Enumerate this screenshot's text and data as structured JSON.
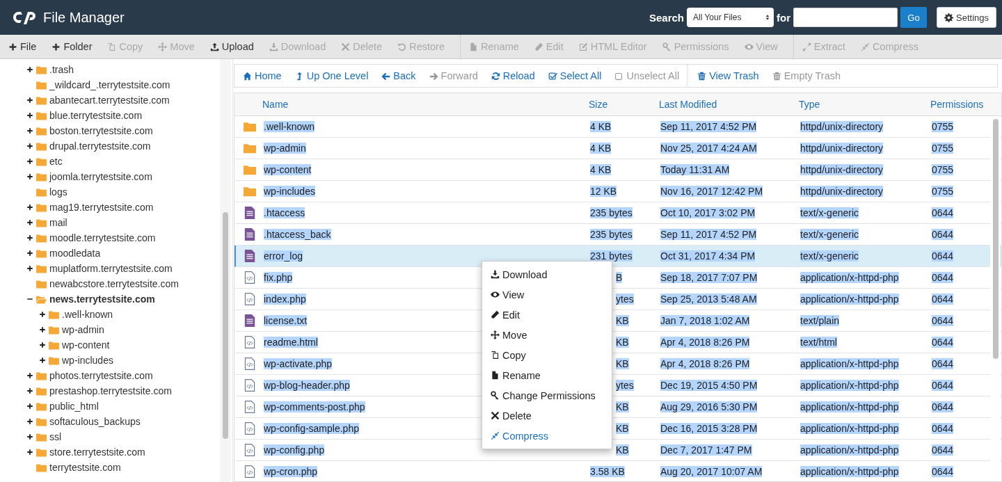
{
  "header": {
    "title": "File Manager",
    "search_label": "Search",
    "scope": "All Your Files",
    "for_label": "for",
    "go": "Go",
    "settings": "Settings"
  },
  "toolbar": [
    [
      {
        "label": "File",
        "disabled": false
      },
      {
        "label": "Folder",
        "disabled": false
      },
      {
        "label": "Copy",
        "disabled": true
      },
      {
        "label": "Move",
        "disabled": true
      },
      {
        "label": "Upload",
        "disabled": false
      },
      {
        "label": "Download",
        "disabled": true
      },
      {
        "label": "Delete",
        "disabled": true
      },
      {
        "label": "Restore",
        "disabled": true
      }
    ],
    [
      {
        "label": "Rename",
        "disabled": true
      },
      {
        "label": "Edit",
        "disabled": true
      },
      {
        "label": "HTML Editor",
        "disabled": true
      },
      {
        "label": "Permissions",
        "disabled": true
      },
      {
        "label": "View",
        "disabled": true
      }
    ],
    [
      {
        "label": "Extract",
        "disabled": true
      },
      {
        "label": "Compress",
        "disabled": true
      }
    ]
  ],
  "tree": [
    {
      "label": ".trash",
      "expandable": true,
      "expanded": false,
      "current": false
    },
    {
      "label": "_wildcard_.terrytestsite.com",
      "expandable": false,
      "expanded": false,
      "current": false
    },
    {
      "label": "abantecart.terrytestsite.com",
      "expandable": true,
      "expanded": false,
      "current": false
    },
    {
      "label": "blue.terrytestsite.com",
      "expandable": true,
      "expanded": false,
      "current": false
    },
    {
      "label": "boston.terrytestsite.com",
      "expandable": true,
      "expanded": false,
      "current": false
    },
    {
      "label": "drupal.terrytestsite.com",
      "expandable": true,
      "expanded": false,
      "current": false
    },
    {
      "label": "etc",
      "expandable": true,
      "expanded": false,
      "current": false
    },
    {
      "label": "joomla.terrytestsite.com",
      "expandable": true,
      "expanded": false,
      "current": false
    },
    {
      "label": "logs",
      "expandable": false,
      "expanded": false,
      "current": false
    },
    {
      "label": "mag19.terrytestsite.com",
      "expandable": true,
      "expanded": false,
      "current": false
    },
    {
      "label": "mail",
      "expandable": true,
      "expanded": false,
      "current": false
    },
    {
      "label": "moodle.terrytestsite.com",
      "expandable": true,
      "expanded": false,
      "current": false
    },
    {
      "label": "moodledata",
      "expandable": true,
      "expanded": false,
      "current": false
    },
    {
      "label": "muplatform.terrytestsite.com",
      "expandable": true,
      "expanded": false,
      "current": false
    },
    {
      "label": "newabcstore.terrytestsite.com",
      "expandable": false,
      "expanded": false,
      "current": false
    },
    {
      "label": "news.terrytestsite.com",
      "expandable": true,
      "expanded": true,
      "current": true,
      "children": [
        {
          "label": ".well-known",
          "expandable": true,
          "expanded": false,
          "current": false
        },
        {
          "label": "wp-admin",
          "expandable": true,
          "expanded": false,
          "current": false
        },
        {
          "label": "wp-content",
          "expandable": true,
          "expanded": false,
          "current": false
        },
        {
          "label": "wp-includes",
          "expandable": true,
          "expanded": false,
          "current": false
        }
      ]
    },
    {
      "label": "photos.terrytestsite.com",
      "expandable": true,
      "expanded": false,
      "current": false
    },
    {
      "label": "prestashop.terrytestsite.com",
      "expandable": true,
      "expanded": false,
      "current": false
    },
    {
      "label": "public_html",
      "expandable": true,
      "expanded": false,
      "current": false
    },
    {
      "label": "softaculous_backups",
      "expandable": true,
      "expanded": false,
      "current": false
    },
    {
      "label": "ssl",
      "expandable": true,
      "expanded": false,
      "current": false
    },
    {
      "label": "store.terrytestsite.com",
      "expandable": true,
      "expanded": false,
      "current": false
    },
    {
      "label": "terrytestsite.com",
      "expandable": false,
      "expanded": false,
      "current": false
    }
  ],
  "navbar": [
    [
      {
        "label": "Home",
        "disabled": false
      },
      {
        "label": "Up One Level",
        "disabled": false
      },
      {
        "label": "Back",
        "disabled": false
      },
      {
        "label": "Forward",
        "disabled": true
      },
      {
        "label": "Reload",
        "disabled": false
      },
      {
        "label": "Select All",
        "disabled": false
      },
      {
        "label": "Unselect All",
        "disabled": true
      }
    ],
    [
      {
        "label": "View Trash",
        "disabled": false
      },
      {
        "label": "Empty Trash",
        "disabled": true
      }
    ]
  ],
  "table": {
    "columns": [
      "Name",
      "Size",
      "Last Modified",
      "Type",
      "Permissions"
    ],
    "rows": [
      {
        "kind": "folder",
        "name": ".well-known",
        "size": "4 KB",
        "modified": "Sep 11, 2017 4:52 PM",
        "type": "httpd/unix-directory",
        "perms": "0755",
        "selected": false,
        "size_cut": false
      },
      {
        "kind": "folder",
        "name": "wp-admin",
        "size": "4 KB",
        "modified": "Nov 25, 2017 4:24 AM",
        "type": "httpd/unix-directory",
        "perms": "0755",
        "selected": false,
        "size_cut": false
      },
      {
        "kind": "folder",
        "name": "wp-content",
        "size": "4 KB",
        "modified": "Today 11:31 AM",
        "type": "httpd/unix-directory",
        "perms": "0755",
        "selected": false,
        "size_cut": false
      },
      {
        "kind": "folder",
        "name": "wp-includes",
        "size": "12 KB",
        "modified": "Nov 16, 2017 12:42 PM",
        "type": "httpd/unix-directory",
        "perms": "0755",
        "selected": false,
        "size_cut": false
      },
      {
        "kind": "text",
        "name": ".htaccess",
        "size": "235 bytes",
        "modified": "Oct 10, 2017 3:02 PM",
        "type": "text/x-generic",
        "perms": "0644",
        "selected": false,
        "size_cut": false
      },
      {
        "kind": "text",
        "name": ".htaccess_back",
        "size": "235 bytes",
        "modified": "Sep 11, 2017 4:52 PM",
        "type": "text/x-generic",
        "perms": "0644",
        "selected": false,
        "size_cut": false
      },
      {
        "kind": "text",
        "name": "error_log",
        "size": "231 bytes",
        "modified": "Oct 31, 2017 4:34 PM",
        "type": "text/x-generic",
        "perms": "0644",
        "selected": true,
        "size_cut": false
      },
      {
        "kind": "code",
        "name": "fix.php",
        "size": "B",
        "modified": "Sep 18, 2017 7:07 PM",
        "type": "application/x-httpd-php",
        "perms": "0644",
        "selected": false,
        "size_cut": true
      },
      {
        "kind": "code",
        "name": "index.php",
        "size": "ytes",
        "modified": "Sep 25, 2013 5:48 AM",
        "type": "application/x-httpd-php",
        "perms": "0644",
        "selected": false,
        "size_cut": true
      },
      {
        "kind": "text",
        "name": "license.txt",
        "size": "KB",
        "modified": "Jan 7, 2018 1:02 AM",
        "type": "text/plain",
        "perms": "0644",
        "selected": false,
        "size_cut": true
      },
      {
        "kind": "code",
        "name": "readme.html",
        "size": "KB",
        "modified": "Apr 4, 2018 8:26 PM",
        "type": "text/html",
        "perms": "0644",
        "selected": false,
        "size_cut": true
      },
      {
        "kind": "code",
        "name": "wp-activate.php",
        "size": "KB",
        "modified": "Apr 4, 2018 8:26 PM",
        "type": "application/x-httpd-php",
        "perms": "0644",
        "selected": false,
        "size_cut": true
      },
      {
        "kind": "code",
        "name": "wp-blog-header.php",
        "size": "ytes",
        "modified": "Dec 19, 2015 4:50 PM",
        "type": "application/x-httpd-php",
        "perms": "0644",
        "selected": false,
        "size_cut": true
      },
      {
        "kind": "code",
        "name": "wp-comments-post.php",
        "size": "KB",
        "modified": "Aug 29, 2016 5:30 PM",
        "type": "application/x-httpd-php",
        "perms": "0644",
        "selected": false,
        "size_cut": true
      },
      {
        "kind": "code",
        "name": "wp-config-sample.php",
        "size": "KB",
        "modified": "Dec 16, 2015 3:28 PM",
        "type": "application/x-httpd-php",
        "perms": "0644",
        "selected": false,
        "size_cut": true
      },
      {
        "kind": "code",
        "name": "wp-config.php",
        "size": "KB",
        "modified": "Dec 7, 2017 1:47 PM",
        "type": "application/x-httpd-php",
        "perms": "0644",
        "selected": false,
        "size_cut": true
      },
      {
        "kind": "code",
        "name": "wp-cron.php",
        "size": "3.58 KB",
        "modified": "Aug 20, 2017 10:07 AM",
        "type": "application/x-httpd-php",
        "perms": "0644",
        "selected": false,
        "size_cut": false
      }
    ]
  },
  "context_menu": [
    {
      "label": "Download",
      "accent": false
    },
    {
      "label": "View",
      "accent": false
    },
    {
      "label": "Edit",
      "accent": false
    },
    {
      "label": "Move",
      "accent": false
    },
    {
      "label": "Copy",
      "accent": false
    },
    {
      "label": "Rename",
      "accent": false
    },
    {
      "label": "Change Permissions",
      "accent": false
    },
    {
      "label": "Delete",
      "accent": false
    },
    {
      "label": "Compress",
      "accent": true
    }
  ]
}
